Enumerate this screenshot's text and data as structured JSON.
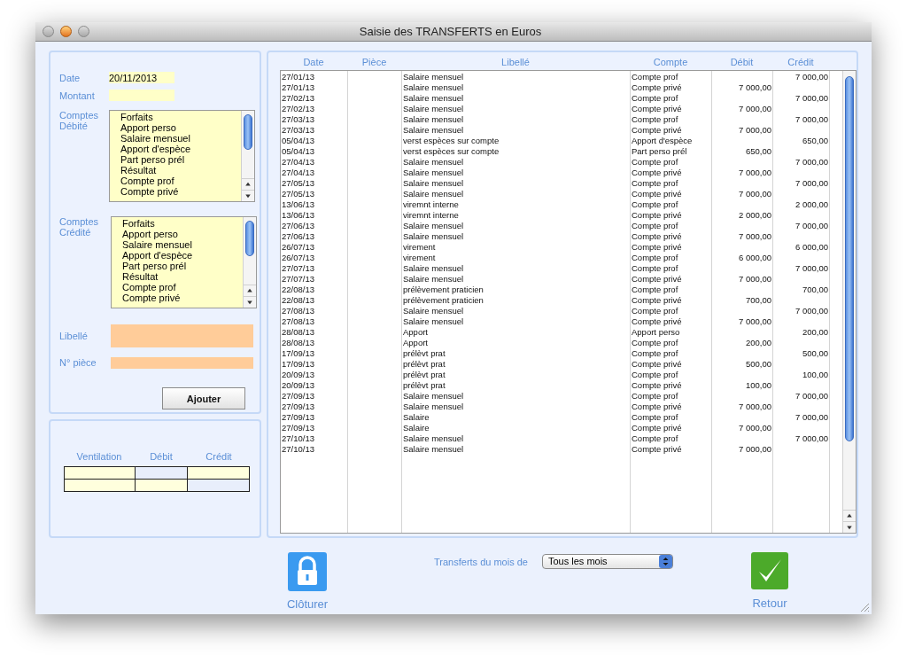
{
  "window": {
    "title": "Saisie des TRANSFERTS en Euros"
  },
  "form": {
    "date": {
      "label": "Date",
      "value": "20/11/2013"
    },
    "montant": {
      "label": "Montant"
    },
    "debit_list": {
      "label": "Comptes Débité",
      "items": [
        "Forfaits",
        "Apport perso",
        "Salaire mensuel",
        "Apport d'espèce",
        "Part perso prél",
        "Résultat",
        "Compte prof",
        "Compte privé"
      ]
    },
    "credit_list": {
      "label": "Comptes Crédité",
      "items": [
        "Forfaits",
        "Apport perso",
        "Salaire mensuel",
        "Apport d'espèce",
        "Part perso prél",
        "Résultat",
        "Compte prof",
        "Compte privé"
      ]
    },
    "libelle": {
      "label": "Libellé"
    },
    "piece": {
      "label": "N° pièce"
    },
    "add_button": "Ajouter"
  },
  "ventilation": {
    "columns": [
      "Ventilation",
      "Débit",
      "Crédit"
    ],
    "rows": [
      {
        "cells": [
          {
            "color": "#ffffdd"
          },
          {
            "color": "#e8eefb"
          },
          {
            "color": "#ffffdd"
          }
        ]
      },
      {
        "cells": [
          {
            "color": "#ffffdd"
          },
          {
            "color": "#ffffdd"
          },
          {
            "color": "#e8eefb"
          }
        ]
      }
    ]
  },
  "table": {
    "columns": [
      "Date",
      "Pièce",
      "Libellé",
      "Compte",
      "Débit",
      "Crédit"
    ],
    "rows": [
      [
        "27/01/13",
        "",
        "Salaire mensuel",
        "Compte prof",
        "",
        "7 000,00"
      ],
      [
        "27/01/13",
        "",
        "Salaire mensuel",
        "Compte privé",
        "7 000,00",
        ""
      ],
      [
        "27/02/13",
        "",
        "Salaire mensuel",
        "Compte prof",
        "",
        "7 000,00"
      ],
      [
        "27/02/13",
        "",
        "Salaire mensuel",
        "Compte privé",
        "7 000,00",
        ""
      ],
      [
        "27/03/13",
        "",
        "Salaire mensuel",
        "Compte prof",
        "",
        "7 000,00"
      ],
      [
        "27/03/13",
        "",
        "Salaire mensuel",
        "Compte privé",
        "7 000,00",
        ""
      ],
      [
        "05/04/13",
        "",
        "verst espèces sur compte",
        "Apport d'espèce",
        "",
        "650,00"
      ],
      [
        "05/04/13",
        "",
        "verst espèces sur compte",
        "Part perso prél",
        "650,00",
        ""
      ],
      [
        "27/04/13",
        "",
        "Salaire mensuel",
        "Compte prof",
        "",
        "7 000,00"
      ],
      [
        "27/04/13",
        "",
        "Salaire mensuel",
        "Compte privé",
        "7 000,00",
        ""
      ],
      [
        "27/05/13",
        "",
        "Salaire mensuel",
        "Compte prof",
        "",
        "7 000,00"
      ],
      [
        "27/05/13",
        "",
        "Salaire mensuel",
        "Compte privé",
        "7 000,00",
        ""
      ],
      [
        "13/06/13",
        "",
        "viremnt interne",
        "Compte prof",
        "",
        "2 000,00"
      ],
      [
        "13/06/13",
        "",
        "viremnt interne",
        "Compte privé",
        "2 000,00",
        ""
      ],
      [
        "27/06/13",
        "",
        "Salaire mensuel",
        "Compte prof",
        "",
        "7 000,00"
      ],
      [
        "27/06/13",
        "",
        "Salaire mensuel",
        "Compte privé",
        "7 000,00",
        ""
      ],
      [
        "26/07/13",
        "",
        "virement",
        "Compte privé",
        "",
        "6 000,00"
      ],
      [
        "26/07/13",
        "",
        "virement",
        "Compte prof",
        "6 000,00",
        ""
      ],
      [
        "27/07/13",
        "",
        "Salaire mensuel",
        "Compte prof",
        "",
        "7 000,00"
      ],
      [
        "27/07/13",
        "",
        "Salaire mensuel",
        "Compte privé",
        "7 000,00",
        ""
      ],
      [
        "22/08/13",
        "",
        "prélèvement praticien",
        "Compte prof",
        "",
        "700,00"
      ],
      [
        "22/08/13",
        "",
        "prélèvement praticien",
        "Compte privé",
        "700,00",
        ""
      ],
      [
        "27/08/13",
        "",
        "Salaire mensuel",
        "Compte prof",
        "",
        "7 000,00"
      ],
      [
        "27/08/13",
        "",
        "Salaire mensuel",
        "Compte privé",
        "7 000,00",
        ""
      ],
      [
        "28/08/13",
        "",
        "Apport",
        "Apport perso",
        "",
        "200,00"
      ],
      [
        "28/08/13",
        "",
        "Apport",
        "Compte prof",
        "200,00",
        ""
      ],
      [
        "17/09/13",
        "",
        "prélèvt prat",
        "Compte prof",
        "",
        "500,00"
      ],
      [
        "17/09/13",
        "",
        "prélèvt prat",
        "Compte privé",
        "500,00",
        ""
      ],
      [
        "20/09/13",
        "",
        "prélèvt prat",
        "Compte prof",
        "",
        "100,00"
      ],
      [
        "20/09/13",
        "",
        "prélèvt prat",
        "Compte privé",
        "100,00",
        ""
      ],
      [
        "27/09/13",
        "",
        "Salaire mensuel",
        "Compte prof",
        "",
        "7 000,00"
      ],
      [
        "27/09/13",
        "",
        "Salaire mensuel",
        "Compte privé",
        "7 000,00",
        ""
      ],
      [
        "27/09/13",
        "",
        "Salaire",
        "Compte prof",
        "",
        "7 000,00"
      ],
      [
        "27/09/13",
        "",
        "Salaire",
        "Compte privé",
        "7 000,00",
        ""
      ],
      [
        "27/10/13",
        "",
        "Salaire mensuel",
        "Compte prof",
        "",
        "7 000,00"
      ],
      [
        "27/10/13",
        "",
        "Salaire mensuel",
        "Compte privé",
        "7 000,00",
        ""
      ]
    ]
  },
  "footer": {
    "close_button": "Clôturer",
    "month_label": "Transferts du mois de",
    "month_value": "Tous les mois",
    "back_button": "Retour"
  }
}
